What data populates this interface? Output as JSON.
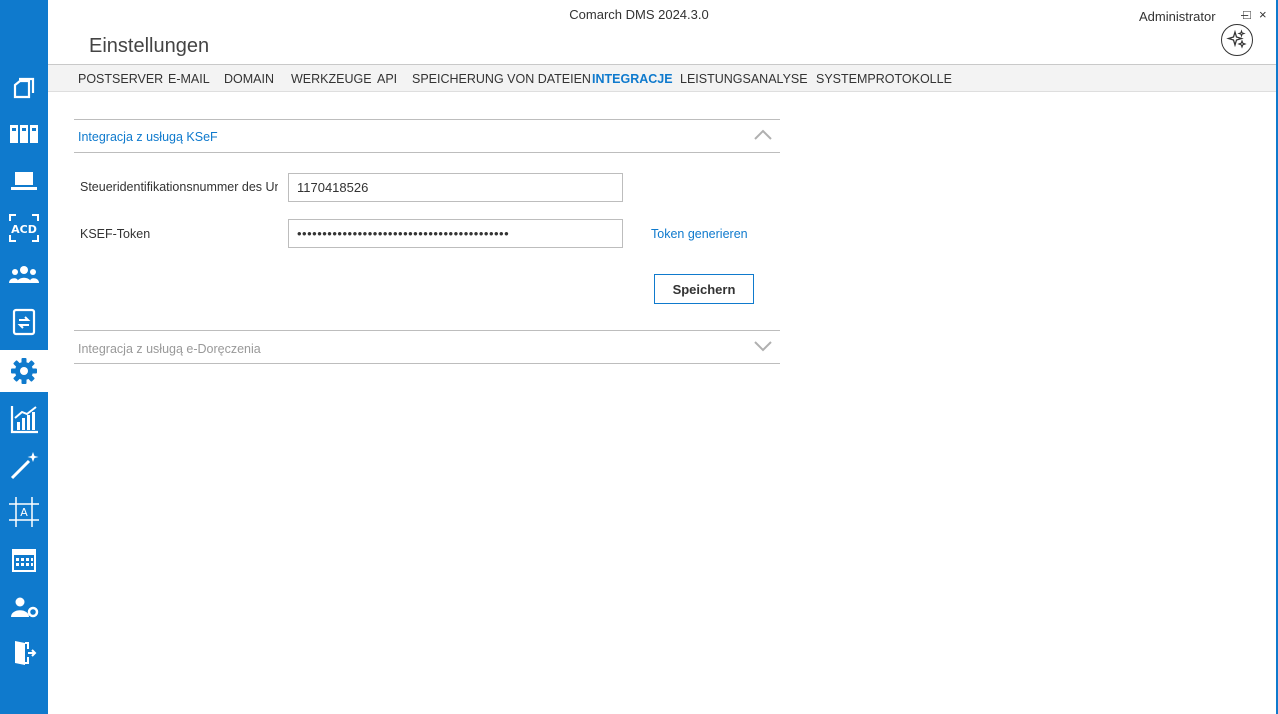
{
  "app": {
    "title": "Comarch DMS 2024.3.0",
    "user": "Administrator",
    "minimize_glyph": "–",
    "maximize_glyph": "□",
    "close_glyph": "×",
    "page_title": "Einstellungen"
  },
  "sidebar": {
    "items": [
      {
        "icon": "documents-icon"
      },
      {
        "icon": "repository-icon"
      },
      {
        "icon": "laptop-icon"
      },
      {
        "icon": "acd-scan-icon"
      },
      {
        "icon": "users-icon"
      },
      {
        "icon": "document-sync-icon"
      },
      {
        "icon": "settings-gear-icon",
        "active": true
      },
      {
        "icon": "analytics-chart-icon"
      },
      {
        "icon": "magic-wand-icon"
      },
      {
        "icon": "text-frame-icon"
      },
      {
        "icon": "calendar-icon"
      },
      {
        "icon": "user-settings-icon"
      },
      {
        "icon": "logout-door-icon"
      }
    ],
    "accent_color": "#0f7acd"
  },
  "tabs": [
    {
      "label": "POSTSERVER"
    },
    {
      "label": "E-MAIL"
    },
    {
      "label": "DOMAIN"
    },
    {
      "label": "WERKZEUGE"
    },
    {
      "label": "API"
    },
    {
      "label": "SPEICHERUNG VON DATEIEN"
    },
    {
      "label": "INTEGRACJE",
      "active": true
    },
    {
      "label": "LEISTUNGSANALYSE"
    },
    {
      "label": "SYSTEMPROTOKOLLE"
    }
  ],
  "ksef": {
    "title": "Integracja z usługą KSeF",
    "expanded": true,
    "nip_label": "Steueridentifikationsnummer des Unternehmens",
    "nip_value": "1170418526",
    "token_label": "KSEF-Token",
    "token_value": "••••••••••••••••••••••••••••••••••••••••••",
    "token_link": "Token generieren",
    "save_label": "Speichern"
  },
  "edoreczenia": {
    "title": "Integracja z usługą e-Doręczenia",
    "expanded": false
  }
}
